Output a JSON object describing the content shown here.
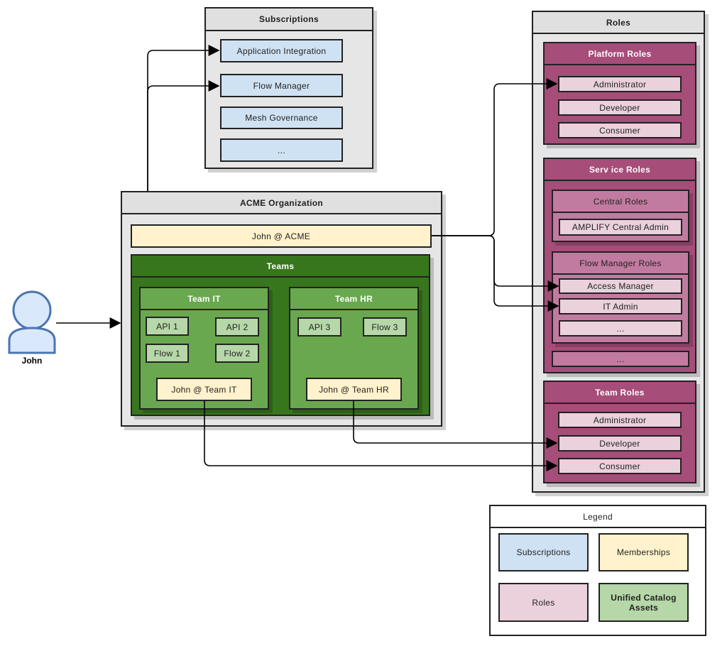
{
  "colors": {
    "subscriptions": "#cfe2f3",
    "memberships": "#fff2cc",
    "roles": "#ead1dc",
    "roles_dark": "#a64d79",
    "assets": "#b6d7a8",
    "teams_dark": "#38761d",
    "team": "#6aa84f"
  },
  "user": {
    "name": "John",
    "icon": "user-icon"
  },
  "subscriptions": {
    "title": "Subscriptions",
    "items": [
      "Application Integration",
      "Flow Manager",
      "Mesh Governance",
      "..."
    ]
  },
  "org": {
    "title": "ACME Organization",
    "membership": "John @ ACME",
    "teams": {
      "title": "Teams",
      "team_it": {
        "title": "Team IT",
        "assets": [
          "API 1",
          "API 2",
          "Flow 1",
          "Flow 2"
        ],
        "membership": "John @ Team IT"
      },
      "team_hr": {
        "title": "Team HR",
        "assets": [
          "API 3",
          "Flow 3"
        ],
        "membership": "John @ Team HR"
      }
    }
  },
  "roles": {
    "title": "Roles",
    "platform": {
      "title": "Platform Roles",
      "items": [
        "Administrator",
        "Developer",
        "Consumer"
      ]
    },
    "service": {
      "title": "Serv ice Roles",
      "central": {
        "title": "Central Roles",
        "items": [
          "AMPLIFY Central Admin"
        ]
      },
      "flow_manager": {
        "title": "Flow Manager Roles",
        "items": [
          "Access Manager",
          "IT Admin",
          "..."
        ]
      },
      "more": "..."
    },
    "team": {
      "title": "Team Roles",
      "items": [
        "Administrator",
        "Developer",
        "Consumer"
      ]
    }
  },
  "legend": {
    "title": "Legend",
    "items": [
      "Subscriptions",
      "Memberships",
      "Roles",
      "Unified Catalog Assets"
    ]
  }
}
